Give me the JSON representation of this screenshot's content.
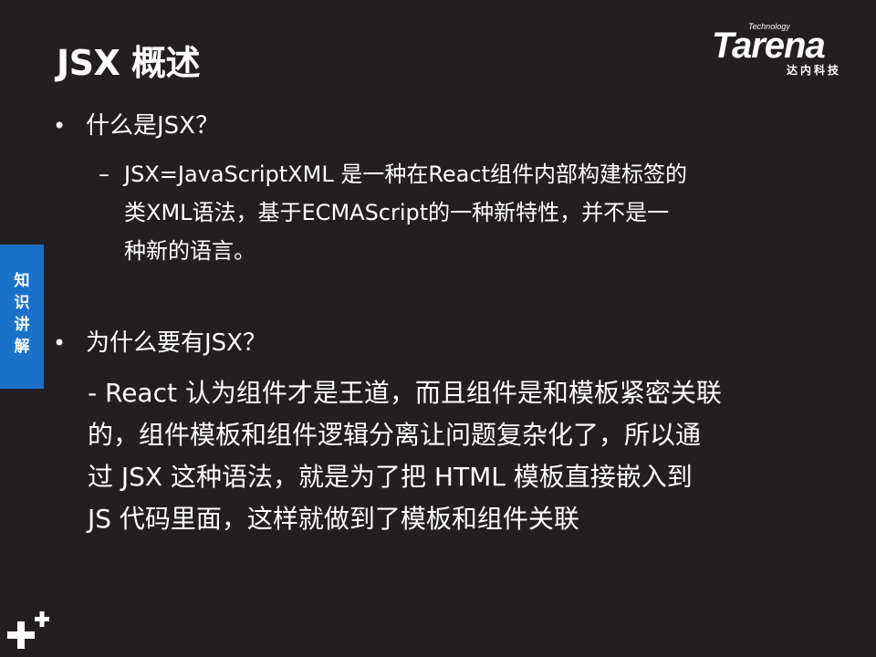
{
  "slide": {
    "title": "JSX 概述",
    "logo": {
      "brand": "Tarena",
      "tagline": "Technology",
      "cn": "达内科技"
    },
    "side_tab": [
      "知",
      "识",
      "讲",
      "解"
    ],
    "bullet1": "什么是JSX？",
    "bullet1_sub": [
      "JSX=JavaScriptXML  是一种在React组件内部构建标签的",
      "类XML语法，基于ECMAScript的一种新特性，并不是一",
      "种新的语言。"
    ],
    "bullet2": "为什么要有JSX？",
    "bullet2_body": [
      "- React 认为组件才是王道，而且组件是和模板紧密关联",
      "的，组件模板和组件逻辑分离让问题复杂化了，所以通",
      "过 JSX 这种语法，就是为了把 HTML 模板直接嵌入到",
      "JS 代码里面，这样就做到了模板和组件关联"
    ],
    "accent_color": "#1a72c8",
    "background_color": "#231f20"
  }
}
